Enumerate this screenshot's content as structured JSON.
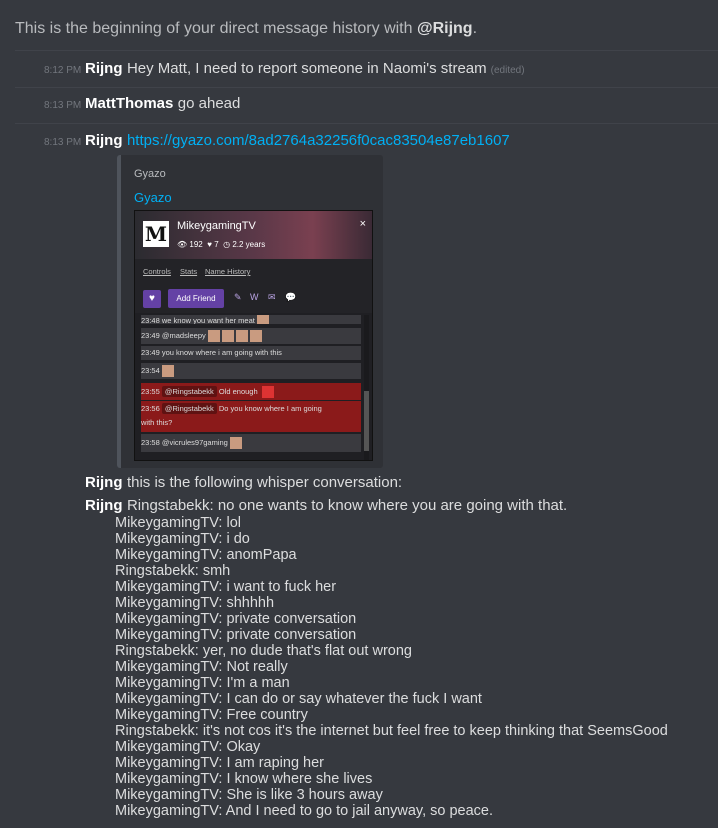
{
  "intro": {
    "prefix": "This is the beginning of your direct message history with ",
    "handle": "@Rijng",
    "suffix": "."
  },
  "messages": [
    {
      "time": "8:12 PM",
      "author": "Rijng",
      "text": "Hey Matt, I need to report someone in Naomi's stream",
      "edited": "(edited)"
    },
    {
      "time": "8:13 PM",
      "author": "MattThomas",
      "text": "go ahead"
    },
    {
      "time": "8:13 PM",
      "author": "Rijng",
      "link": "https://gyazo.com/8ad2764a32256f0cac83504e87eb1607"
    }
  ],
  "embed": {
    "provider": "Gyazo",
    "title": "Gyazo",
    "screenshot": {
      "logo": "M",
      "name": "MikeygamingTV",
      "views": "192",
      "follows": "7",
      "age": "2.2 years",
      "close": "×",
      "tabs": [
        "Controls",
        "Stats",
        "Name History"
      ],
      "add_friend": "Add Friend",
      "chat": [
        {
          "time": "23:48",
          "text": "we know you want her meat",
          "style": "plain"
        },
        {
          "time": "23:49",
          "mention": "@madsleepy",
          "text": "",
          "style": "plain",
          "emotes": 4
        },
        {
          "time": "23:49",
          "text": "you know where i am going with this",
          "style": "plain"
        },
        {
          "time": "23:54",
          "text": "",
          "style": "plain",
          "emotes": 1
        },
        {
          "time": "23:55",
          "mention": "@Ringstabekk",
          "text": "Old enough",
          "style": "red"
        },
        {
          "time": "23:56",
          "mention": "@Ringstabekk",
          "text": "Do you know where I am going",
          "style": "red"
        },
        {
          "time": "",
          "text": "with this?",
          "style": "red"
        },
        {
          "time": "23:58",
          "mention": "@vicrules97gaming",
          "text": "",
          "style": "plain",
          "emotes": 1
        }
      ]
    }
  },
  "followup": [
    {
      "author": "Rijng",
      "text": "this is the following whisper conversation:"
    },
    {
      "author": "Rijng",
      "text": "Ringstabekk: no one wants to know where you are going with that."
    }
  ],
  "conversation": [
    "MikeygamingTV: lol",
    "MikeygamingTV: i do",
    "MikeygamingTV: anomPapa",
    "Ringstabekk: smh",
    "MikeygamingTV: i want to fuck her",
    "MikeygamingTV: shhhhh",
    "MikeygamingTV: private conversation",
    "MikeygamingTV: private conversation",
    "Ringstabekk: yer, no dude that's flat out wrong",
    "MikeygamingTV: Not really",
    "MikeygamingTV: I'm a man",
    "MikeygamingTV: I can do or say whatever the fuck I want",
    "MikeygamingTV: Free country",
    "Ringstabekk: it's not cos it's the internet but feel free to keep thinking that SeemsGood",
    "MikeygamingTV: Okay",
    "MikeygamingTV: I am raping her",
    "MikeygamingTV: I know where she lives",
    "MikeygamingTV: She is like 3 hours away",
    "MikeygamingTV: And I need to go to jail anyway, so peace."
  ]
}
